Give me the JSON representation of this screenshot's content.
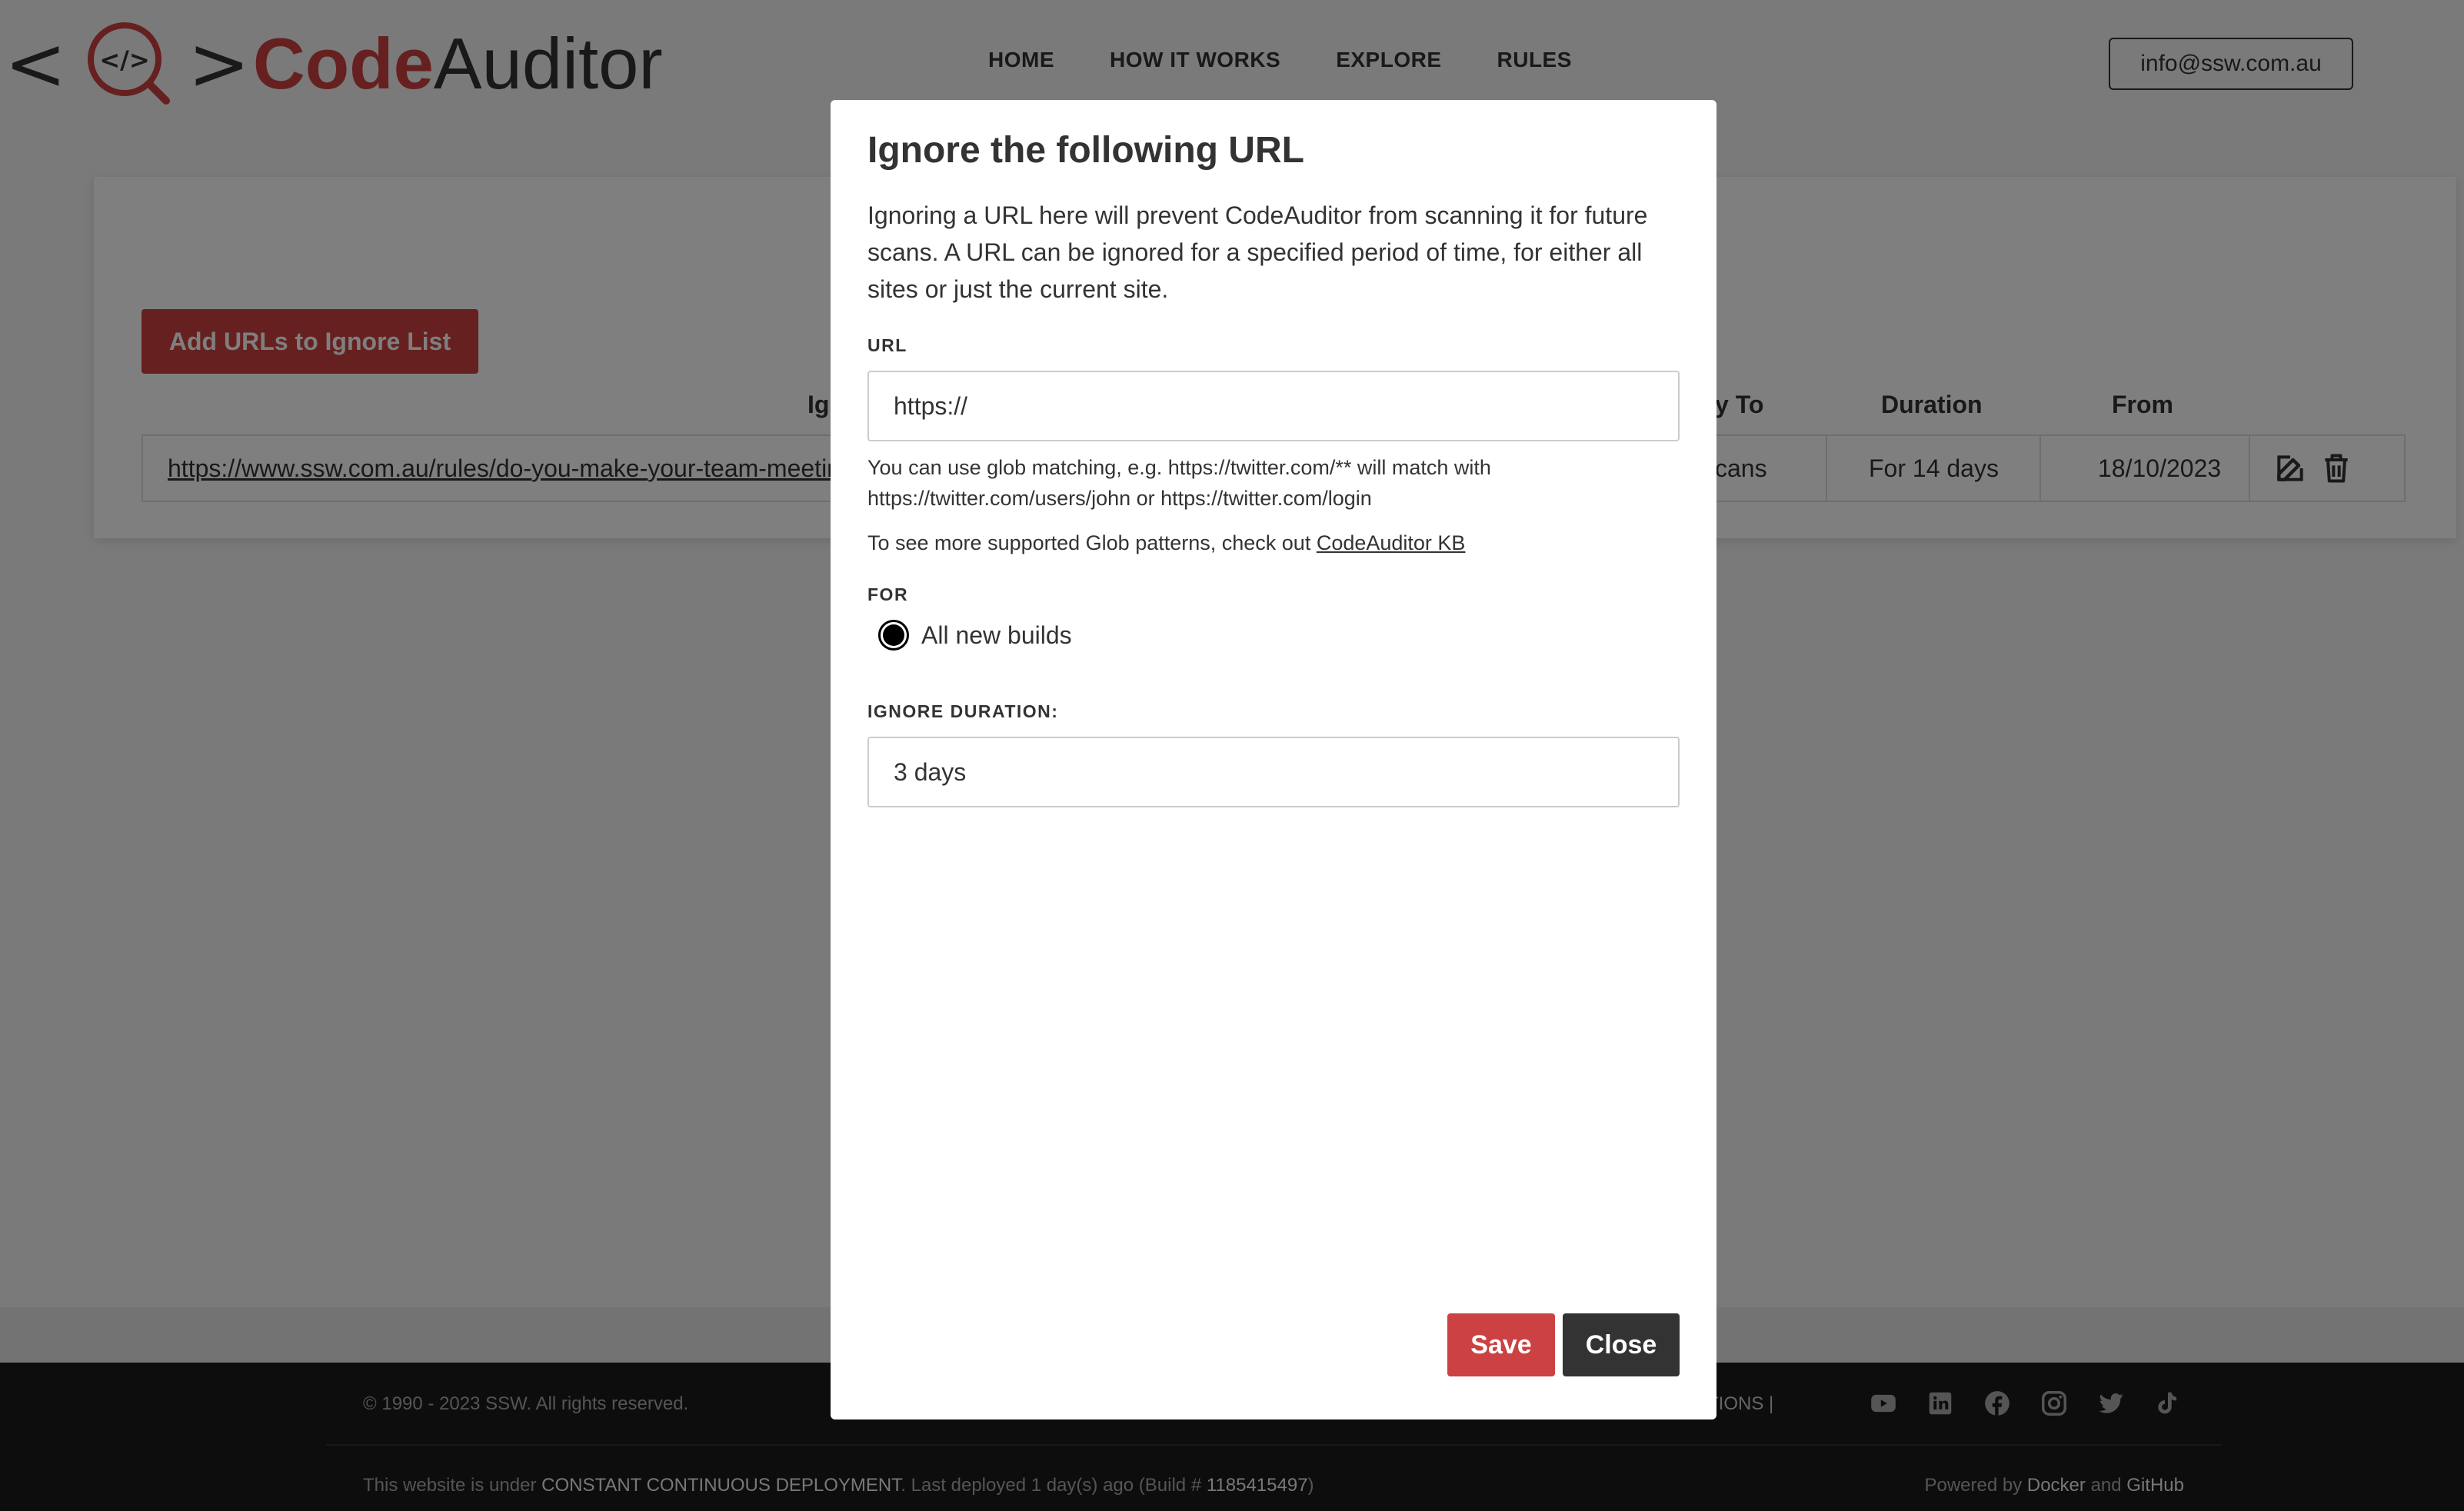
{
  "header": {
    "logo_left": "<",
    "logo_right": ">",
    "brand_code": "Code",
    "brand_auditor": "Auditor",
    "nav": [
      "HOME",
      "HOW IT WORKS",
      "EXPLORE",
      "RULES"
    ],
    "email": "info@ssw.com.au"
  },
  "main": {
    "add_button": "Add URLs to Ignore List",
    "columns": {
      "ignore_url_partial": "Ig",
      "apply_to_partial": "y To",
      "duration": "Duration",
      "from": "From"
    },
    "row": {
      "url": "https://www.ssw.com.au/rules/do-you-make-your-team-meetings-easy-to-find/",
      "apply_to_partial": "cans",
      "duration": "For 14 days",
      "from": "18/10/2023"
    }
  },
  "footer": {
    "copyright": "© 1990 - 2023 SSW. All rights reserved.",
    "terms_partial": "ONDITIONS   |",
    "deploy_prefix": "This website is under ",
    "deploy_strong": "CONSTANT CONTINUOUS DEPLOYMENT",
    "deploy_mid": ". Last deployed 1 day(s) ago (Build # ",
    "build_number": "1185415497",
    "deploy_suffix": ")",
    "powered_prefix": "Powered by ",
    "powered_docker": "Docker",
    "powered_and": " and ",
    "powered_github": "GitHub",
    "social_icons": [
      "youtube-icon",
      "linkedin-icon",
      "facebook-icon",
      "instagram-icon",
      "twitter-icon",
      "tiktok-icon"
    ]
  },
  "modal": {
    "title": "Ignore the following URL",
    "description": "Ignoring a URL here will prevent CodeAuditor from scanning it for future scans. A URL can be ignored for a specified period of time, for either all sites or just the current site.",
    "url_label": "URL",
    "url_value": "https://",
    "glob_help": "You can use glob matching, e.g. https://twitter.com/** will match with https://twitter.com/users/john or https://twitter.com/login",
    "kb_prefix": "To see more supported Glob patterns, check out ",
    "kb_link": "CodeAuditor KB",
    "for_label": "FOR",
    "for_option": "All new builds",
    "duration_label": "IGNORE DURATION:",
    "duration_value": "3 days",
    "save": "Save",
    "close": "Close"
  },
  "colors": {
    "brand_red": "#cc4141",
    "dark": "#333333",
    "footer_bg": "#1a1a1a"
  }
}
